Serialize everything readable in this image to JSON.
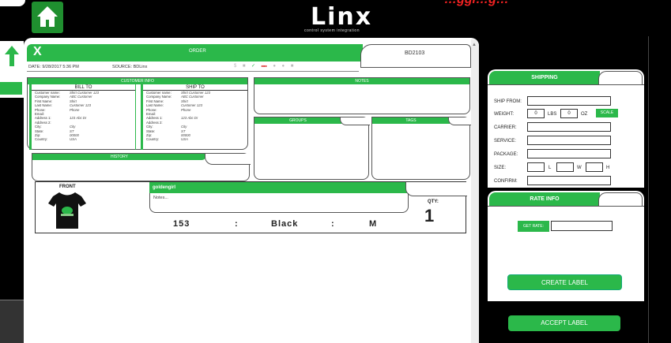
{
  "app": {
    "logo_word": "Linx",
    "logo_sub": "control system integration",
    "promo": "…ggi…g…"
  },
  "order": {
    "title": "ORDER",
    "order_id": "BD2103",
    "date_label": "DATE:",
    "date": "9/28/2017 5:36 PM",
    "source_label": "SOURCE:",
    "source": "BDLinx"
  },
  "customer_info": {
    "header": "CUSTOMER INFO",
    "bill_to": {
      "header": "BILL TO",
      "fields": [
        {
          "k": "Customer name:",
          "v": "Shirt Customer 123"
        },
        {
          "k": "Company Name:",
          "v": "ABC Customer"
        },
        {
          "k": "First Name:",
          "v": "Shirt"
        },
        {
          "k": "Last Name:",
          "v": "Customer 123"
        },
        {
          "k": "Phone:",
          "v": "Phone"
        },
        {
          "k": "Email:",
          "v": ""
        },
        {
          "k": "Address 1:",
          "v": "123 Abc Dr"
        },
        {
          "k": "Address 2:",
          "v": ""
        },
        {
          "k": "City:",
          "v": "City"
        },
        {
          "k": "State:",
          "v": "ST"
        },
        {
          "k": "Zip:",
          "v": "00000"
        },
        {
          "k": "Country:",
          "v": "USA"
        }
      ]
    },
    "ship_to": {
      "header": "SHIP TO",
      "fields": [
        {
          "k": "Customer name:",
          "v": "Shirt Customer 123"
        },
        {
          "k": "Company Name:",
          "v": "ABC Customer"
        },
        {
          "k": "First Name:",
          "v": "Shirt"
        },
        {
          "k": "Last Name:",
          "v": "Customer 123"
        },
        {
          "k": "Phone:",
          "v": "Phone"
        },
        {
          "k": "Email:",
          "v": ""
        },
        {
          "k": "Address 1:",
          "v": "123 Abc Dr"
        },
        {
          "k": "Address 2:",
          "v": ""
        },
        {
          "k": "City:",
          "v": "City"
        },
        {
          "k": "State:",
          "v": "ST"
        },
        {
          "k": "Zip:",
          "v": "00000"
        },
        {
          "k": "Country:",
          "v": "USA"
        }
      ]
    }
  },
  "history": {
    "header": "HISTORY"
  },
  "notes": {
    "header": "NOTES"
  },
  "groups": {
    "header": "GROUPS"
  },
  "tags": {
    "header": "TAGS"
  },
  "item": {
    "front_label": "FRONT",
    "name": "goldengirl",
    "notes": "Notes...",
    "qty_label": "QTY:",
    "qty": "1",
    "style": "153",
    "sep1": ":",
    "color": "Black",
    "sep2": ":",
    "size": "M"
  },
  "shipping": {
    "header": "SHIPPING",
    "ship_from_label": "SHIP FROM:",
    "weight_label": "WEIGHT:",
    "lbs_value": "0",
    "lbs_label": "LBS",
    "oz_value": "0",
    "oz_label": "OZ",
    "scale_label": "SCALE",
    "carrier_label": "CARRIER:",
    "service_label": "SERVICE:",
    "package_label": "PACKAGE:",
    "size_label": "SIZE:",
    "l_label": "L",
    "w_label": "W",
    "h_label": "H",
    "confirm_label": "CONFIRM:"
  },
  "rate_info": {
    "header": "RATE INFO",
    "get_rate_label": "GET RATE:",
    "create_label": "CREATE LABEL"
  },
  "accept_label": "ACCEPT LABEL",
  "colors": {
    "accent": "#2bb84a",
    "background": "#000000",
    "panel": "#ffffff"
  }
}
